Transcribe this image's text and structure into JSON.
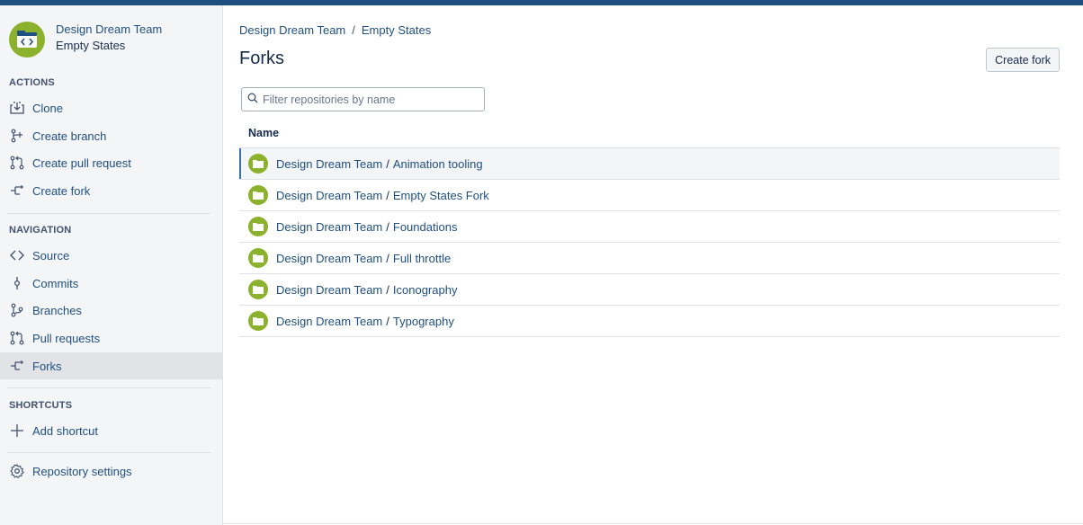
{
  "repo": {
    "project": "Design Dream Team",
    "name": "Empty States"
  },
  "sidebar": {
    "actions_title": "ACTIONS",
    "actions": [
      {
        "label": "Clone",
        "icon": "clone-icon"
      },
      {
        "label": "Create branch",
        "icon": "create-branch-icon"
      },
      {
        "label": "Create pull request",
        "icon": "pull-request-icon"
      },
      {
        "label": "Create fork",
        "icon": "fork-icon"
      }
    ],
    "navigation_title": "NAVIGATION",
    "navigation": [
      {
        "label": "Source",
        "icon": "source-icon"
      },
      {
        "label": "Commits",
        "icon": "commit-icon"
      },
      {
        "label": "Branches",
        "icon": "branch-icon"
      },
      {
        "label": "Pull requests",
        "icon": "pull-request-icon"
      },
      {
        "label": "Forks",
        "icon": "fork-icon",
        "active": true
      }
    ],
    "shortcuts_title": "SHORTCUTS",
    "shortcuts": [
      {
        "label": "Add shortcut",
        "icon": "plus-icon"
      }
    ],
    "settings": {
      "label": "Repository settings",
      "icon": "gear-icon"
    }
  },
  "breadcrumb": {
    "project": "Design Dream Team",
    "separator": "/",
    "repo": "Empty States"
  },
  "page": {
    "title": "Forks",
    "create_fork_label": "Create fork"
  },
  "filter": {
    "placeholder": "Filter repositories by name",
    "value": ""
  },
  "table": {
    "column_name": "Name",
    "rows": [
      {
        "project": "Design Dream Team",
        "repo": "Animation tooling"
      },
      {
        "project": "Design Dream Team",
        "repo": "Empty States Fork"
      },
      {
        "project": "Design Dream Team",
        "repo": "Foundations"
      },
      {
        "project": "Design Dream Team",
        "repo": "Full throttle"
      },
      {
        "project": "Design Dream Team",
        "repo": "Iconography"
      },
      {
        "project": "Design Dream Team",
        "repo": "Typography"
      }
    ]
  },
  "colors": {
    "accent": "#205081",
    "repo_avatar": "#8cb22d",
    "sidebar_bg": "#f4f5f7",
    "active_item": "#e2e3e6"
  }
}
